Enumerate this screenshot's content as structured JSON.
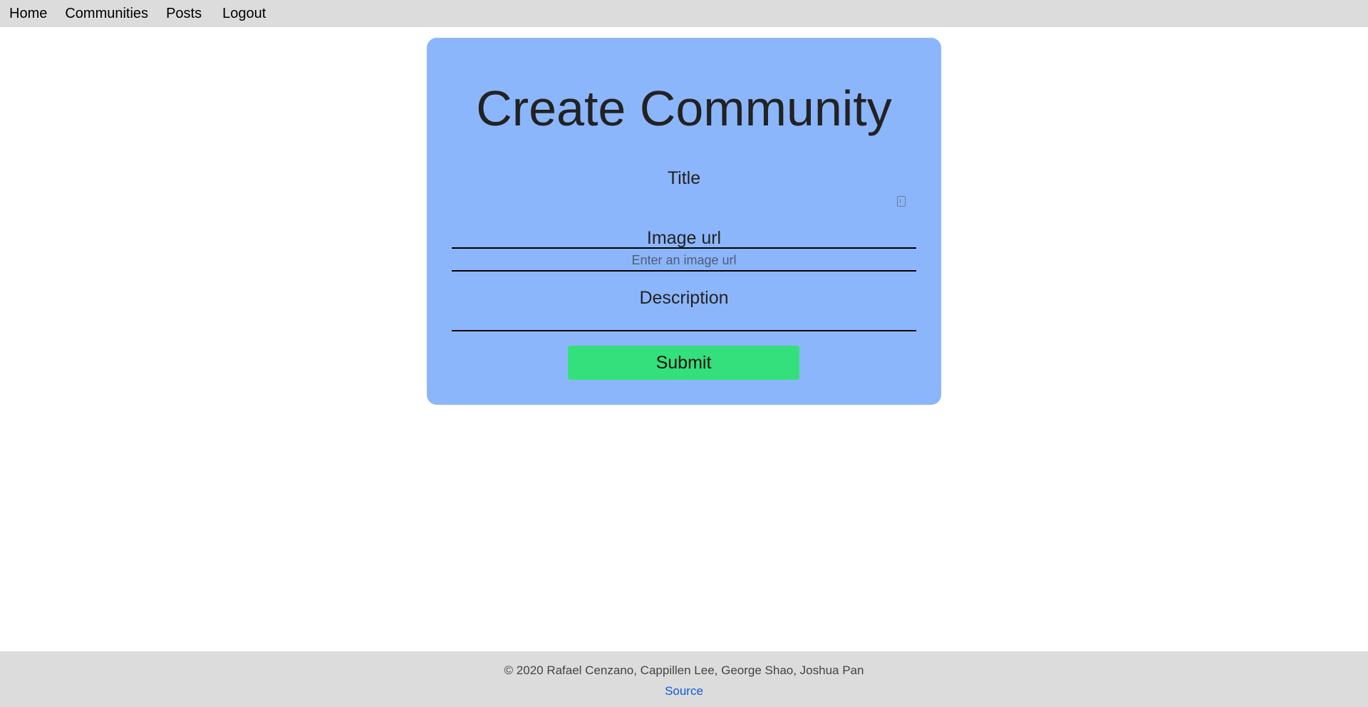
{
  "nav": {
    "items": [
      {
        "label": "Home"
      },
      {
        "label": "Communities"
      },
      {
        "label": "Posts"
      },
      {
        "label": "Logout"
      }
    ]
  },
  "form": {
    "title": "Create Community",
    "fields": {
      "title": {
        "label": "Title",
        "value": "",
        "placeholder": ""
      },
      "image_url": {
        "label": "Image url",
        "value": "",
        "placeholder": "Enter an image url"
      },
      "description": {
        "label": "Description",
        "value": "",
        "placeholder": ""
      }
    },
    "submit_label": "Submit",
    "card_color": "#8cb6fb",
    "submit_color": "#34e07b"
  },
  "footer": {
    "copyright": "© 2020 Rafael Cenzano, Cappillen Lee, George Shao, Joshua Pan",
    "source_label": "Source"
  },
  "icons": {
    "title_field_icon": "password-manager-icon"
  }
}
